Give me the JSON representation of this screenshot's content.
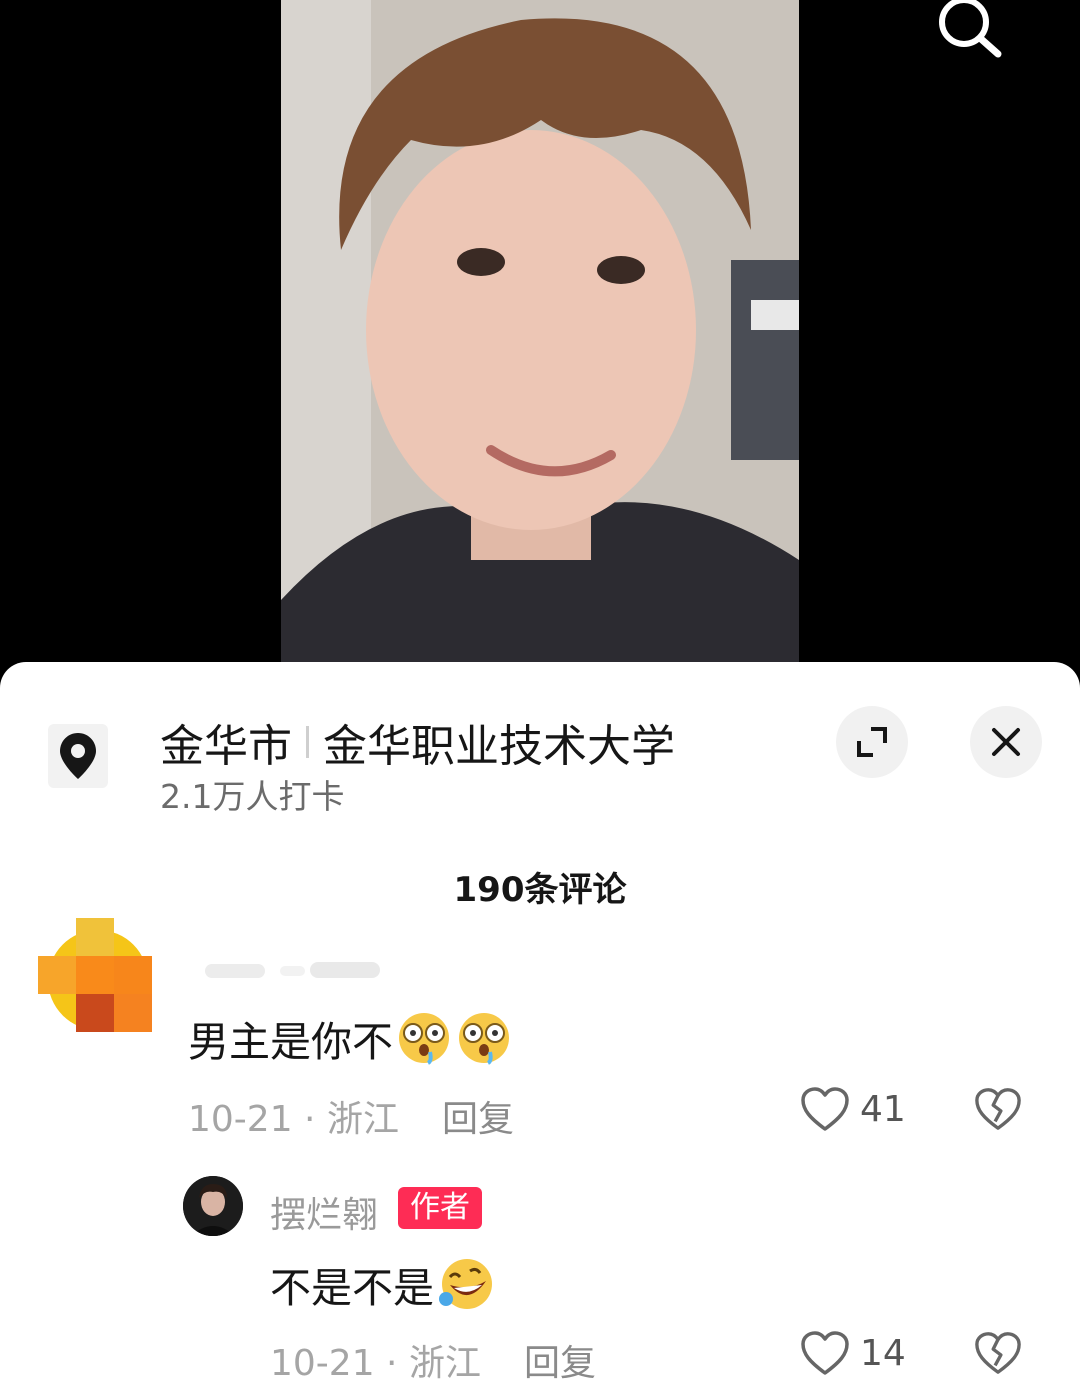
{
  "location": {
    "city": "金华市",
    "place": "金华职业技术大学",
    "checkins": "2.1万人打卡"
  },
  "comments_header": "190条评论",
  "comment": {
    "text": "男主是你不",
    "emojis": [
      "drooling-shocked-face-emoji",
      "drooling-shocked-face-emoji"
    ],
    "date": "10-21 · 浙江",
    "reply_label": "回复",
    "likes": "41"
  },
  "reply": {
    "username": "摆烂翱",
    "badge": "作者",
    "text": "不是不是",
    "emojis": [
      "rolling-laughing-face-emoji"
    ],
    "date": "10-21 · 浙江",
    "reply_label": "回复",
    "likes": "14"
  },
  "colors": {
    "accent_badge": "#fe2c55",
    "sheet_bg": "#ffffff",
    "video_bg": "#000000"
  }
}
